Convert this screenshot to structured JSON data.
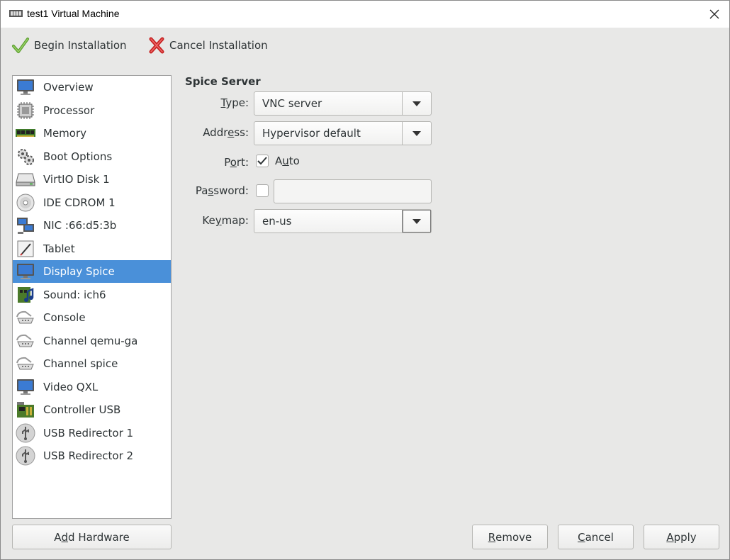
{
  "window": {
    "title": "test1 Virtual Machine"
  },
  "toolbar": {
    "begin_label": "Begin Installation",
    "cancel_label": "Cancel Installation"
  },
  "sidebar": {
    "selected": "Display Spice",
    "items": [
      {
        "label": "Overview",
        "icon": "monitor-icon"
      },
      {
        "label": "Processor",
        "icon": "processor-icon"
      },
      {
        "label": "Memory",
        "icon": "memory-icon"
      },
      {
        "label": "Boot Options",
        "icon": "gears-icon"
      },
      {
        "label": "VirtIO Disk 1",
        "icon": "disk-icon"
      },
      {
        "label": "IDE CDROM 1",
        "icon": "cdrom-icon"
      },
      {
        "label": "NIC :66:d5:3b",
        "icon": "network-icon"
      },
      {
        "label": "Tablet",
        "icon": "tablet-icon"
      },
      {
        "label": "Display Spice",
        "icon": "monitor-icon"
      },
      {
        "label": "Sound: ich6",
        "icon": "sound-icon"
      },
      {
        "label": "Console",
        "icon": "serial-icon"
      },
      {
        "label": "Channel qemu-ga",
        "icon": "serial-icon"
      },
      {
        "label": "Channel spice",
        "icon": "serial-icon"
      },
      {
        "label": "Video QXL",
        "icon": "monitor-icon"
      },
      {
        "label": "Controller USB",
        "icon": "controller-icon"
      },
      {
        "label": "USB Redirector 1",
        "icon": "usb-icon"
      },
      {
        "label": "USB Redirector 2",
        "icon": "usb-icon"
      }
    ],
    "add_hardware": {
      "pre": "A",
      "mn": "d",
      "post": "d Hardware"
    }
  },
  "details": {
    "section_title": "Spice Server",
    "type": {
      "label_mn": "T",
      "label_rest": "ype:",
      "value": "VNC server"
    },
    "address": {
      "label_pre": "Addr",
      "label_mn": "e",
      "label_rest": "ss:",
      "value": "Hypervisor default"
    },
    "port": {
      "label_pre": "P",
      "label_mn": "o",
      "label_rest": "rt:",
      "auto_checked": true,
      "auto_pre": "A",
      "auto_mn": "u",
      "auto_rest": "to"
    },
    "password": {
      "label_pre": "Pa",
      "label_mn": "s",
      "label_rest": "sword:",
      "checked": false,
      "value": ""
    },
    "keymap": {
      "label_pre": "Ke",
      "label_mn": "y",
      "label_rest": "map:",
      "value": "en-us"
    }
  },
  "buttons": {
    "remove": {
      "mn": "R",
      "rest": "emove"
    },
    "cancel": {
      "mn": "C",
      "rest": "ancel"
    },
    "apply": {
      "mn": "A",
      "rest": "pply"
    }
  },
  "colors": {
    "selection": "#4a90d9",
    "window_bg": "#e8e8e7"
  }
}
